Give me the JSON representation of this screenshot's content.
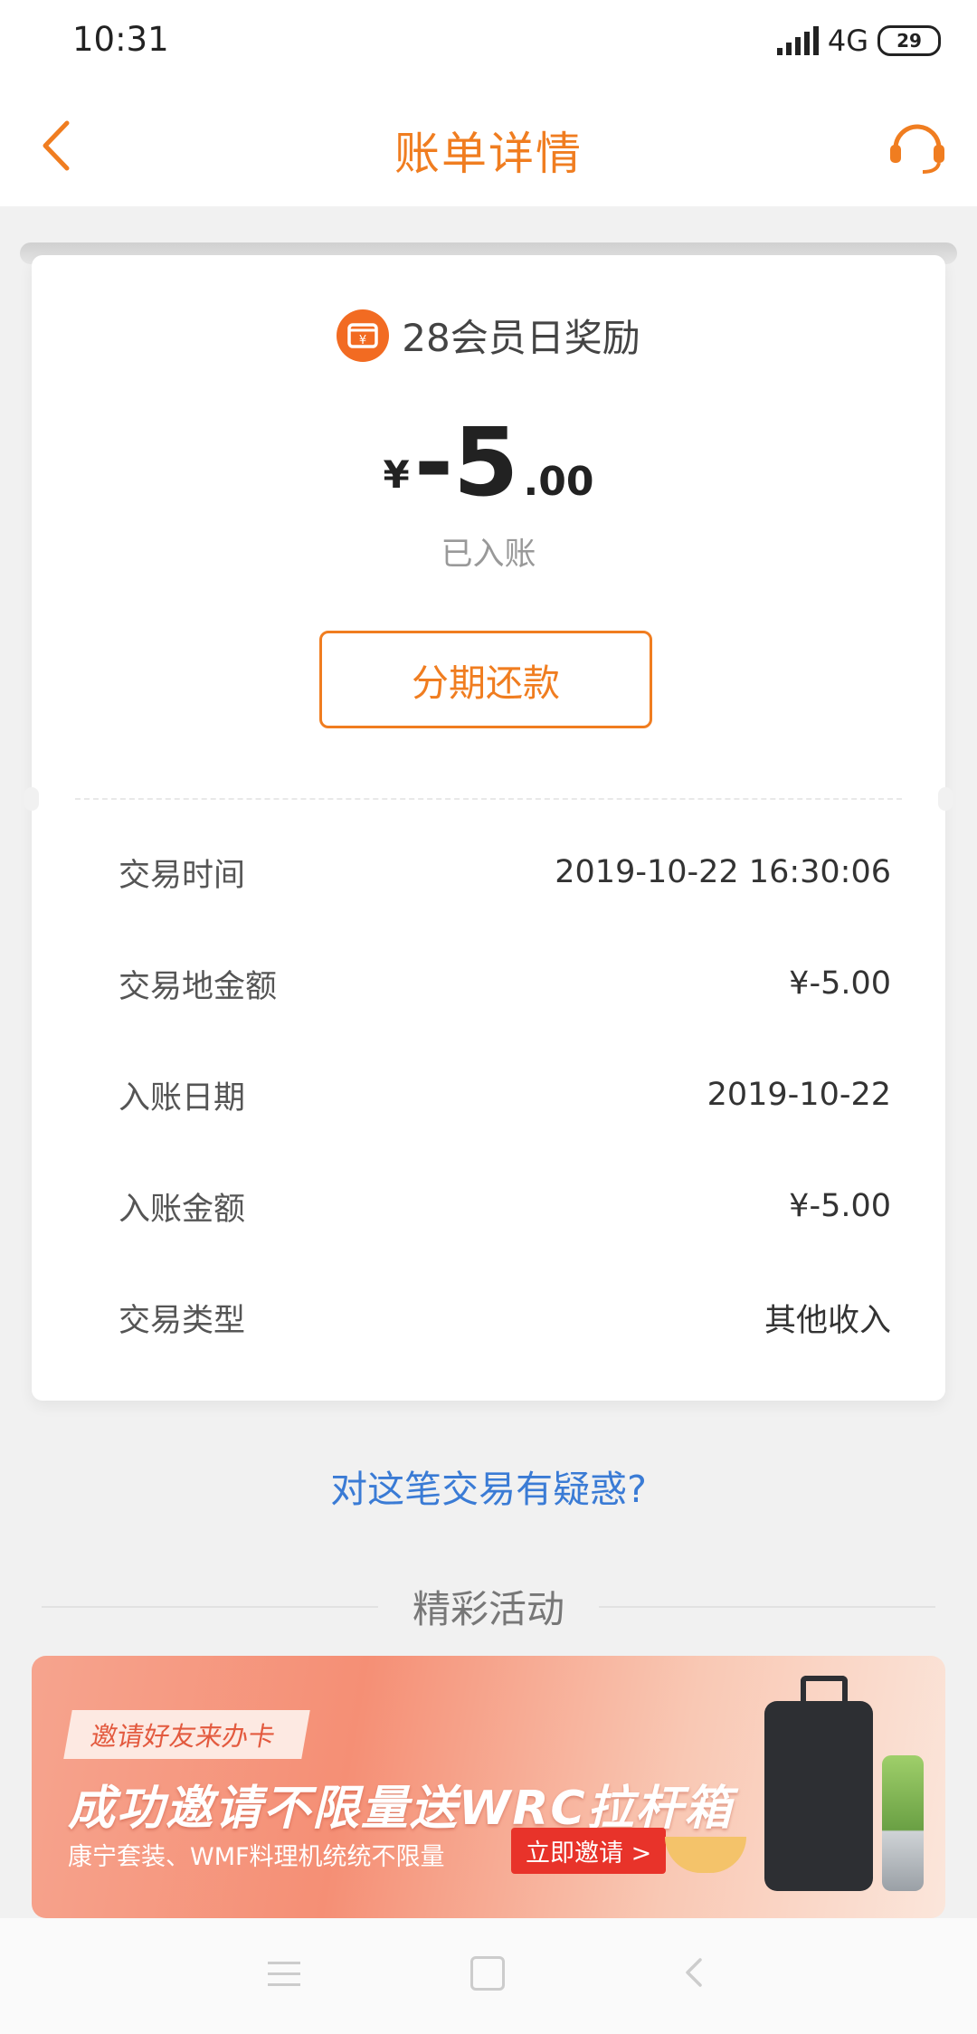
{
  "status_bar": {
    "time": "10:31",
    "network": "4G",
    "battery": "29"
  },
  "nav": {
    "title": "账单详情",
    "back_icon": "chevron-left-icon",
    "service_icon": "headset-icon"
  },
  "colors": {
    "accent": "#f07d20",
    "link": "#3a7bd5",
    "merchant_icon_bg": "#f26b22"
  },
  "transaction": {
    "merchant_icon": "wallet-icon",
    "merchant": "28会员日奖励",
    "currency": "¥",
    "amount_int": "-5",
    "amount_dec": ".00",
    "status": "已入账",
    "installment_button": "分期还款"
  },
  "details": [
    {
      "label": "交易时间",
      "value": "2019-10-22 16:30:06"
    },
    {
      "label": "交易地金额",
      "value": "¥-5.00"
    },
    {
      "label": "入账日期",
      "value": "2019-10-22"
    },
    {
      "label": "入账金额",
      "value": "¥-5.00"
    },
    {
      "label": "交易类型",
      "value": "其他收入"
    }
  ],
  "doubt_link": "对这笔交易有疑惑?",
  "activities": {
    "title": "精彩活动",
    "banner": {
      "tag": "邀请好友来办卡",
      "headline": "成功邀请不限量送WRC拉杆箱",
      "subtitle": "康宁套装、WMF料理机统统不限量",
      "cta": "立即邀请 >"
    }
  },
  "system_nav": {
    "menu_icon": "menu-icon",
    "home_icon": "home-square-icon",
    "back_icon": "back-triangle-icon"
  }
}
